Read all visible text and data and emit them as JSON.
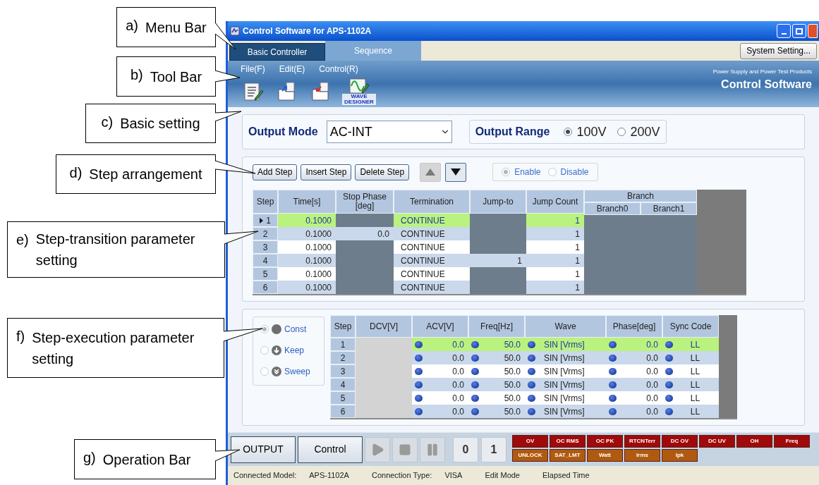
{
  "callouts": [
    {
      "marker": "a)",
      "text": "Menu Bar"
    },
    {
      "marker": "b)",
      "text": "Tool Bar"
    },
    {
      "marker": "c)",
      "text": "Basic setting"
    },
    {
      "marker": "d)",
      "text": "Step arrangement"
    },
    {
      "marker": "e)",
      "text": "Step-transition parameter setting"
    },
    {
      "marker": "f)",
      "text": "Step-execution parameter setting"
    },
    {
      "marker": "g)",
      "text": "Operation Bar"
    }
  ],
  "window": {
    "title": "Control Software for APS-1102A"
  },
  "tabs": [
    {
      "label": "Basic Controller",
      "selected": false
    },
    {
      "label": "Sequence",
      "selected": true
    }
  ],
  "system_button": "System Setting...",
  "menu": [
    "File(F)",
    "Edit(E)",
    "Control(R)"
  ],
  "toolbar": [
    {
      "kind": "edit"
    },
    {
      "kind": "open"
    },
    {
      "kind": "save"
    },
    {
      "kind": "wave",
      "label": "WAVE DESIGNER"
    }
  ],
  "branding": {
    "tagline": "Power Supply and Power Test Products",
    "name": "Control Software"
  },
  "basic": {
    "mode_label": "Output Mode",
    "mode_value": "AC-INT",
    "range_label": "Output Range",
    "ranges": [
      {
        "label": "100V",
        "selected": true
      },
      {
        "label": "200V",
        "selected": false
      }
    ]
  },
  "step_buttons": [
    "Add Step",
    "Insert Step",
    "Delete Step"
  ],
  "move_buttons": [
    {
      "kind": "up",
      "disabled": true
    },
    {
      "kind": "down",
      "disabled": false
    }
  ],
  "branch_mode": {
    "disabled": true,
    "options": [
      {
        "label": "Enable",
        "selected": true
      },
      {
        "label": "Disable",
        "selected": false
      }
    ]
  },
  "transition_table": {
    "columns": [
      "Step",
      "Time[s]",
      "Stop Phase [deg]",
      "Termination",
      "Jump-to",
      "Jump Count"
    ],
    "branch": {
      "label": "Branch",
      "columns": [
        "Branch0",
        "Branch1"
      ]
    },
    "rows": [
      {
        "step": "1",
        "selected": true,
        "time": "0.1000",
        "termination": "CONTINUE",
        "jump_count": "1"
      },
      {
        "step": "2",
        "selected": false,
        "time": "0.1000",
        "stop_phase": "0.0",
        "termination": "CONTINUE",
        "jump_count": "1"
      },
      {
        "step": "3",
        "selected": false,
        "time": "0.1000",
        "termination": "CONTINUE",
        "jump_count": "1"
      },
      {
        "step": "4",
        "selected": false,
        "time": "0.1000",
        "termination": "CONTINUE",
        "jump_to": "1",
        "jump_count": "1"
      },
      {
        "step": "5",
        "selected": false,
        "time": "0.1000",
        "termination": "CONTINUE",
        "jump_count": "1"
      },
      {
        "step": "6",
        "selected": false,
        "time": "0.1000",
        "termination": "CONTINUE",
        "jump_count": "1"
      }
    ]
  },
  "execution_modes": [
    {
      "kind": "const",
      "label": "Const",
      "selected": true
    },
    {
      "kind": "keep",
      "label": "Keep",
      "selected": false
    },
    {
      "kind": "sweep",
      "label": "Sweep",
      "selected": false
    }
  ],
  "execution_table": {
    "columns": [
      "Step",
      "DCV[V]",
      "ACV[V]",
      "Freq[Hz]",
      "Wave",
      "Phase[deg]",
      "Sync Code"
    ],
    "rows": [
      {
        "step": "1",
        "selected": true,
        "acv": "0.0",
        "freq": "50.0",
        "wave": "SIN [Vrms]",
        "phase": "0.0",
        "sync": "LL"
      },
      {
        "step": "2",
        "selected": false,
        "acv": "0.0",
        "freq": "50.0",
        "wave": "SIN [Vrms]",
        "phase": "0.0",
        "sync": "LL"
      },
      {
        "step": "3",
        "selected": false,
        "acv": "0.0",
        "freq": "50.0",
        "wave": "SIN [Vrms]",
        "phase": "0.0",
        "sync": "LL"
      },
      {
        "step": "4",
        "selected": false,
        "acv": "0.0",
        "freq": "50.0",
        "wave": "SIN [Vrms]",
        "phase": "0.0",
        "sync": "LL"
      },
      {
        "step": "5",
        "selected": false,
        "acv": "0.0",
        "freq": "50.0",
        "wave": "SIN [Vrms]",
        "phase": "0.0",
        "sync": "LL"
      },
      {
        "step": "6",
        "selected": false,
        "acv": "0.0",
        "freq": "50.0",
        "wave": "SIN [Vrms]",
        "phase": "0.0",
        "sync": "LL"
      }
    ]
  },
  "operation": {
    "buttons": [
      "OUTPUT",
      "Control"
    ],
    "transport": [
      {
        "kind": "play",
        "disabled": true
      },
      {
        "kind": "stop",
        "disabled": true
      },
      {
        "kind": "pause",
        "disabled": true
      }
    ],
    "counters": [
      "0",
      "1"
    ],
    "alarms": [
      [
        {
          "label": "OV",
          "color": "#a00a0a"
        },
        {
          "label": "OC RMS",
          "color": "#a00a0a"
        },
        {
          "label": "OC PK",
          "color": "#a00a0a"
        },
        {
          "label": "RTCNTerr",
          "color": "#a00a0a"
        },
        {
          "label": "DC OV",
          "color": "#a00a0a"
        },
        {
          "label": "DC UV",
          "color": "#a00a0a"
        },
        {
          "label": "OH",
          "color": "#a00a0a"
        },
        {
          "label": "Freq",
          "color": "#a00a0a"
        }
      ],
      [
        {
          "label": "UNLOCK",
          "color": "#b05a10"
        },
        {
          "label": "SAT_LMT",
          "color": "#b05a10"
        },
        {
          "label": "Watt",
          "color": "#b05a10"
        },
        {
          "label": "Irms",
          "color": "#b05a10"
        },
        {
          "label": "Ipk",
          "color": "#b05a10"
        }
      ]
    ]
  },
  "status": [
    {
      "label": "Connected Model:",
      "value": "APS-1102A"
    },
    {
      "label": "Connection Type:",
      "value": "VISA"
    },
    {
      "label": "Edit Mode"
    },
    {
      "label": "Elapsed Time"
    }
  ]
}
